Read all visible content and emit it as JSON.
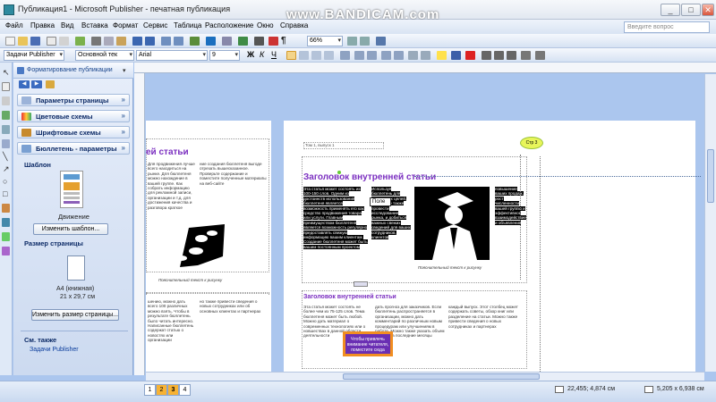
{
  "window": {
    "title": "Публикация1 - Microsoft Publisher - печатная публикация",
    "watermark": "www.BANDICAM.com",
    "min": "_",
    "max": "□",
    "close": "✕"
  },
  "menu": {
    "items": [
      "Файл",
      "Правка",
      "Вид",
      "Вставка",
      "Формат",
      "Сервис",
      "Таблица",
      "Расположение",
      "Окно",
      "Справка"
    ],
    "help_placeholder": "Введите вопрос"
  },
  "toolbar": {
    "zoom": "66%",
    "tasks": "Задачи Publisher",
    "style": "Основной тек",
    "font": "Arial",
    "size": "9"
  },
  "taskpane": {
    "header": "Форматирование публикации",
    "sections": [
      "Параметры страницы",
      "Цветовые схемы",
      "Шрифтовые схемы",
      "Бюллетень - параметры"
    ],
    "template_label": "Шаблон",
    "template_name": "Движение",
    "change_template": "Изменить шаблон...",
    "page_size_label": "Размер страницы",
    "page_size_name": "A4 (книжная)",
    "page_size_dims": "21 x 29,7 см",
    "change_size": "Изменить размер страницы...",
    "see_also": "См. также",
    "see_also_link": "Задачи Publisher"
  },
  "page_left": {
    "heading": "ей статьи",
    "caption": "Пояснительный текст к рисунку"
  },
  "page_right": {
    "header_field": "Том 1, выпуск 1",
    "page_label": "Стр 3",
    "heading": "Заголовок внутренней статьи",
    "caption": "Пояснительный текст к рисунку",
    "heading2": "Заголовок внутренней статьи",
    "tooltip": "Поле",
    "callout": "Чтобы привлечь внимание читателя, поместите сюда"
  },
  "status": {
    "pages": [
      "1",
      "2",
      "3",
      "4"
    ],
    "active_page": "3",
    "position": "22,455; 4,874 см",
    "size": "5,205 x 6,938 см"
  },
  "colors": {
    "accent": "#7b2fc0",
    "selection": "#000000",
    "page_tab_active": "#f7b233"
  }
}
